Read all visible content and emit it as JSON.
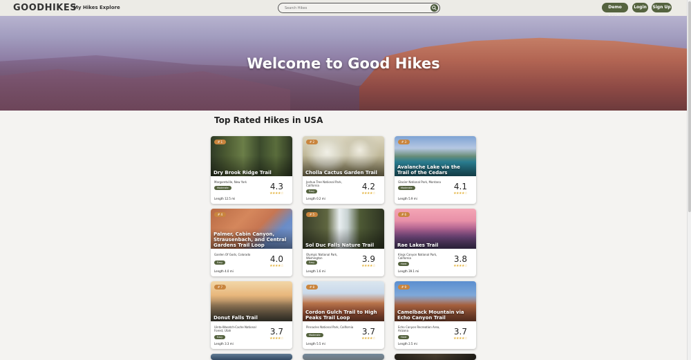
{
  "header": {
    "logo": "GOODHIKES",
    "nav": [
      "My Hikes",
      "Explore"
    ],
    "search_placeholder": "Search Hikes",
    "buttons": [
      "Demo Login",
      "Login",
      "Sign Up"
    ]
  },
  "hero": {
    "title": "Welcome to Good Hikes"
  },
  "section": {
    "title": "Top Rated Hikes in USA"
  },
  "colors": {
    "accent": "#55633f",
    "rank_badge": "#c9853e",
    "stars": "#e3b23c"
  },
  "cards": [
    {
      "rank": "# 1",
      "name": "Dry Brook Ridge Trail",
      "location": "Margaretville, New York",
      "difficulty": "Moderate",
      "rating": "4.3",
      "length": "Length 12.5 mi",
      "stars": "★★★★☆"
    },
    {
      "rank": "# 2",
      "name": "Cholla Cactus Garden Trail",
      "location": "Joshua Tree National Park, California",
      "difficulty": "Easy",
      "rating": "4.2",
      "length": "Length 0.2 mi",
      "stars": "★★★★☆"
    },
    {
      "rank": "# 3",
      "name": "Avalanche Lake via the Trail of the Cedars",
      "location": "Glacier National Park, Montana",
      "difficulty": "Moderate",
      "rating": "4.1",
      "length": "Length 5.9 mi",
      "stars": "★★★★☆"
    },
    {
      "rank": "# 4",
      "name": "Palmer, Cabin Canyon, Strausenbach, and Central Gardens Trail Loop",
      "location": "Garden Of Gods, Colorado",
      "difficulty": "Easy",
      "rating": "4.0",
      "length": "Length 4.0 mi",
      "stars": "★★★★☆"
    },
    {
      "rank": "# 5",
      "name": "Sol Duc Falls Nature Trail",
      "location": "Olympic National Park, Washington",
      "difficulty": "Easy",
      "rating": "3.9",
      "length": "Length 1.6 mi",
      "stars": "★★★★☆"
    },
    {
      "rank": "# 6",
      "name": "Rae Lakes Trail",
      "location": "Kings Canyon National Park, California",
      "difficulty": "Hard",
      "rating": "3.8",
      "length": "Length 39.1 mi",
      "stars": "★★★★☆"
    },
    {
      "rank": "# 7",
      "name": "Donut Falls Trail",
      "location": "Uinta-Wasatch-Cache National Forest, Utah",
      "difficulty": "Easy",
      "rating": "3.7",
      "length": "Length 3.3 mi",
      "stars": "★★★★☆"
    },
    {
      "rank": "# 8",
      "name": "Cordon Gulch Trail to High Peaks Trail Loop",
      "location": "Pinnacles National Park, California",
      "difficulty": "Moderate",
      "rating": "3.7",
      "length": "Length 5.5 mi",
      "stars": "★★★★☆"
    },
    {
      "rank": "# 9",
      "name": "Camelback Mountain via Echo Canyon Trail",
      "location": "Echo Canyon Recreation Area, Arizona",
      "difficulty": "Hard",
      "rating": "3.7",
      "length": "Length 2.5 mi",
      "stars": "★★★★☆"
    }
  ]
}
